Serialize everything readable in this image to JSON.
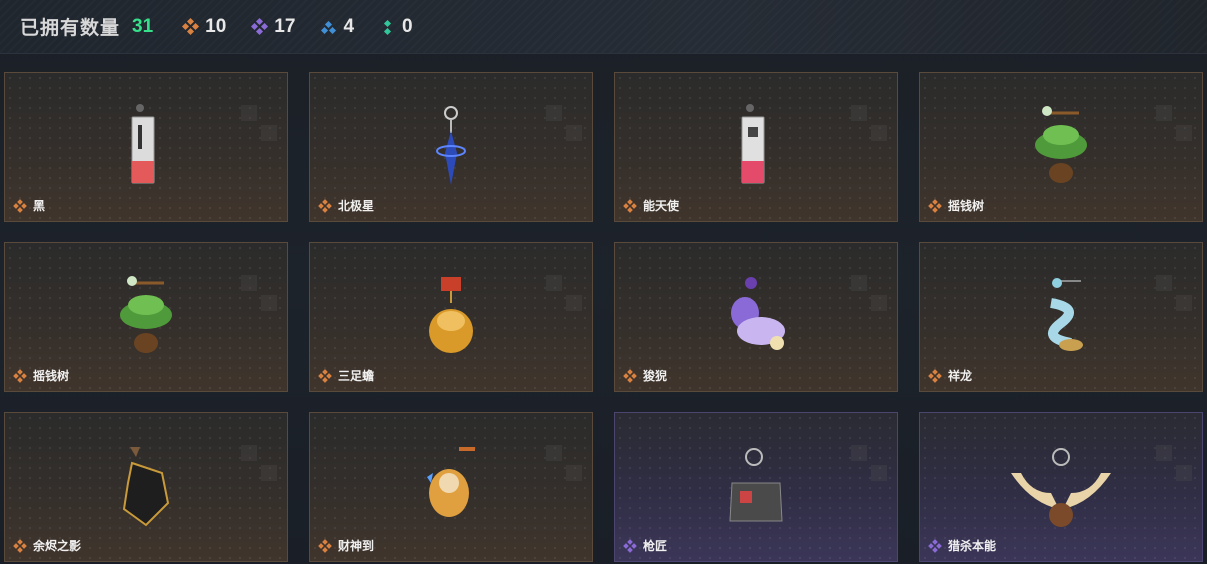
{
  "header": {
    "owned_label": "已拥有数量",
    "owned_count": "31",
    "stats": [
      {
        "icon": "orange-gem-icon",
        "value": "10",
        "color": "#d9813f"
      },
      {
        "icon": "purple-gem-icon",
        "value": "17",
        "color": "#8a6ad6"
      },
      {
        "icon": "blue-gem-icon",
        "value": "4",
        "color": "#3f8fd6"
      },
      {
        "icon": "green-gem-icon",
        "value": "0",
        "color": "#2fc79a"
      }
    ]
  },
  "items": [
    {
      "name": "黑",
      "rarity": "orange",
      "art": "tag-charm"
    },
    {
      "name": "北极星",
      "rarity": "orange",
      "art": "blue-star-charm"
    },
    {
      "name": "能天使",
      "rarity": "orange",
      "art": "tag-charm"
    },
    {
      "name": "摇钱树",
      "rarity": "orange",
      "art": "money-tree-charm"
    },
    {
      "name": "摇钱树",
      "rarity": "orange",
      "art": "money-tree-charm"
    },
    {
      "name": "三足蟾",
      "rarity": "orange",
      "art": "toad-charm"
    },
    {
      "name": "狻猊",
      "rarity": "orange",
      "art": "lion-charm"
    },
    {
      "name": "祥龙",
      "rarity": "orange",
      "art": "dragon-charm"
    },
    {
      "name": "余烬之影",
      "rarity": "orange",
      "art": "shadow-charm"
    },
    {
      "name": "财神到",
      "rarity": "orange",
      "art": "fortune-charm"
    },
    {
      "name": "枪匠",
      "rarity": "purple",
      "art": "gunsmith-charm"
    },
    {
      "name": "猎杀本能",
      "rarity": "purple",
      "art": "antler-charm"
    }
  ]
}
